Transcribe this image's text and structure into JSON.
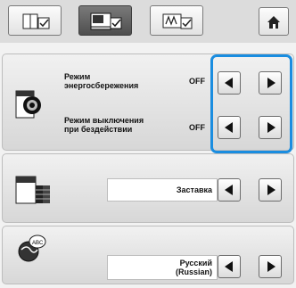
{
  "tabs": [
    {
      "name": "tab-sewing-settings",
      "icon": "sewing-settings-icon"
    },
    {
      "name": "tab-machine-settings",
      "icon": "machine-settings-icon",
      "active": true
    },
    {
      "name": "tab-embroidery-settings",
      "icon": "embroidery-settings-icon"
    }
  ],
  "home_icon": "home-icon",
  "settings": {
    "eco_mode": {
      "label": "Режим\nэнергосбережения",
      "value": "OFF"
    },
    "shutoff_mode": {
      "label": "Режим выключения\nпри бездействии",
      "value": "OFF"
    },
    "screensaver": {
      "value": "Заставка"
    },
    "language": {
      "value": "Русский\n(Russian)"
    }
  },
  "colors": {
    "highlight": "#1a8de0"
  }
}
